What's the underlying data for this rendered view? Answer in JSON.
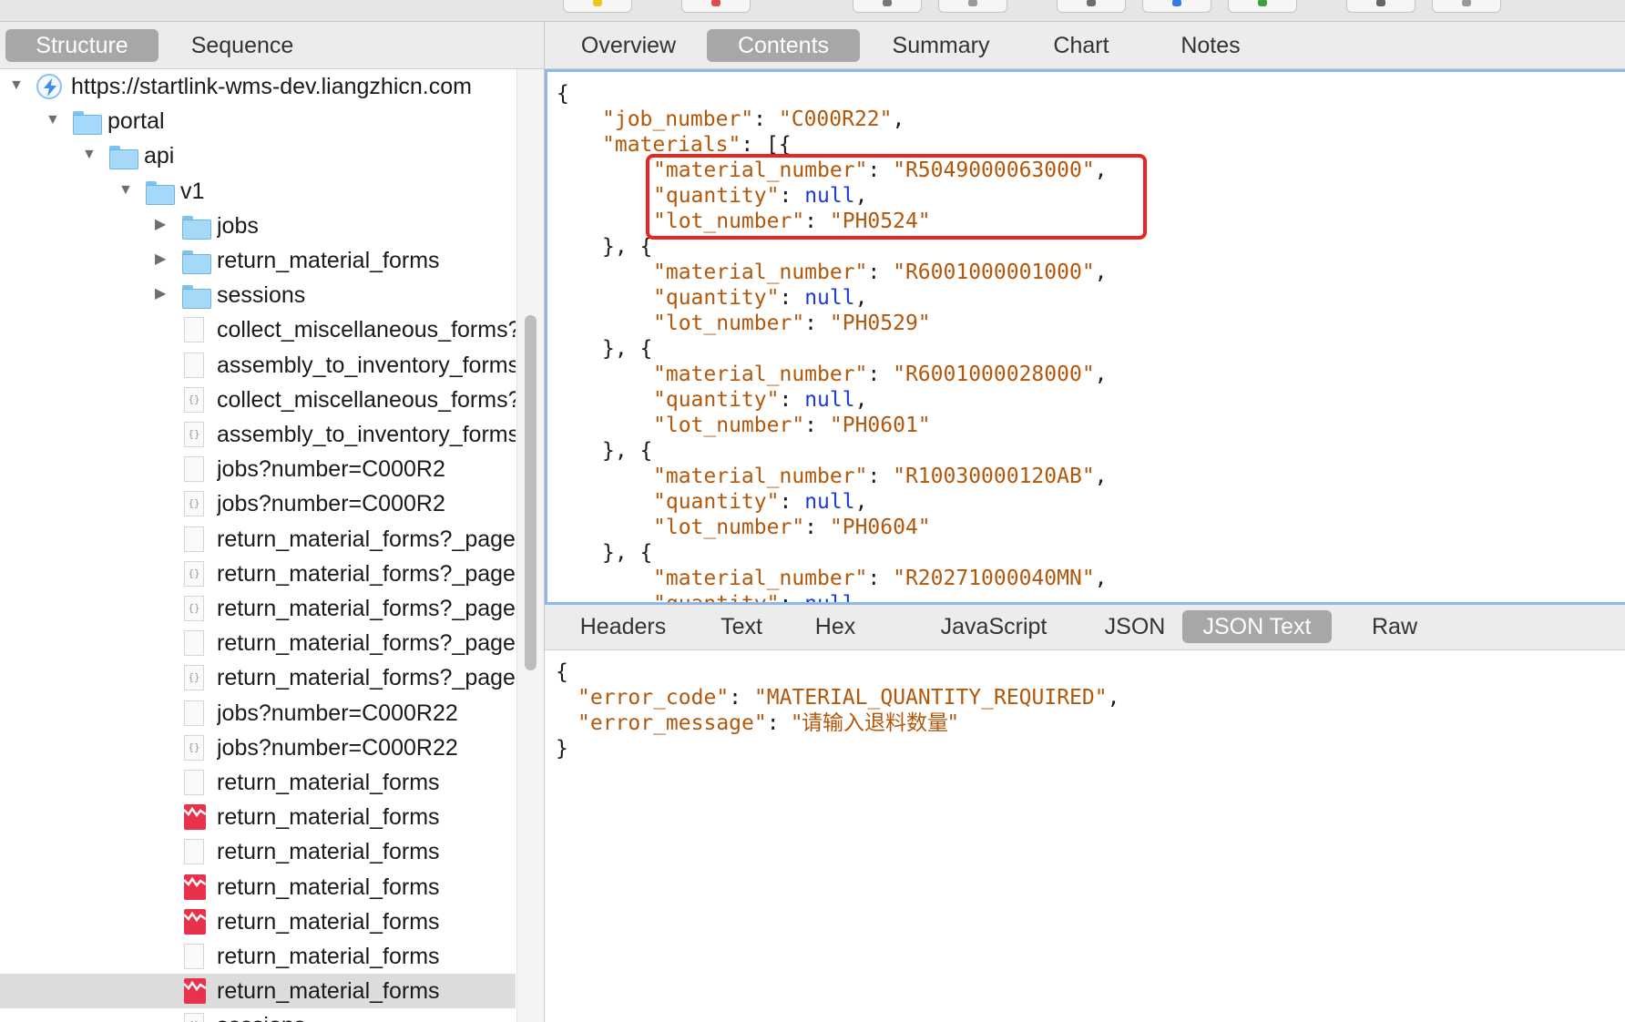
{
  "toolbar": {
    "buttons": [
      {
        "icon": "pen-icon",
        "color": "#f0c419"
      },
      {
        "icon": "record-icon",
        "color": "#e24b4b"
      },
      {
        "icon": "throttle-icon",
        "color": "#777777"
      },
      {
        "icon": "clear-icon",
        "color": "#999999"
      },
      {
        "icon": "search-icon",
        "color": "#6e6e6e"
      },
      {
        "icon": "compose-icon",
        "color": "#2f7de1"
      },
      {
        "icon": "check-icon",
        "color": "#3aa141"
      },
      {
        "icon": "tools-icon",
        "color": "#666666"
      },
      {
        "icon": "settings-icon",
        "color": "#999999"
      }
    ]
  },
  "left_tabs": [
    {
      "label": "Structure",
      "active": true
    },
    {
      "label": "Sequence",
      "active": false
    }
  ],
  "tree": {
    "host": "https://startlink-wms-dev.liangzhicn.com",
    "rows": [
      {
        "label": "portal",
        "icon": "folder",
        "level": 1,
        "expanded": true
      },
      {
        "label": "api",
        "icon": "folder",
        "level": 2,
        "expanded": true
      },
      {
        "label": "v1",
        "icon": "folder",
        "level": 3,
        "expanded": true
      },
      {
        "label": "jobs",
        "icon": "folder",
        "level": 4,
        "expanded": false
      },
      {
        "label": "return_material_forms",
        "icon": "folder",
        "level": 4,
        "expanded": false
      },
      {
        "label": "sessions",
        "icon": "folder",
        "level": 4,
        "expanded": false
      },
      {
        "label": "collect_miscellaneous_forms?",
        "icon": "doc",
        "level": 4
      },
      {
        "label": "assembly_to_inventory_forms",
        "icon": "doc",
        "level": 4
      },
      {
        "label": "collect_miscellaneous_forms?",
        "icon": "json",
        "level": 4
      },
      {
        "label": "assembly_to_inventory_forms",
        "icon": "json",
        "level": 4
      },
      {
        "label": "jobs?number=C000R2",
        "icon": "doc",
        "level": 4
      },
      {
        "label": "jobs?number=C000R2",
        "icon": "json",
        "level": 4
      },
      {
        "label": "return_material_forms?_page=",
        "icon": "doc",
        "level": 4
      },
      {
        "label": "return_material_forms?_page=",
        "icon": "json",
        "level": 4
      },
      {
        "label": "return_material_forms?_page=",
        "icon": "json",
        "level": 4
      },
      {
        "label": "return_material_forms?_page=",
        "icon": "doc",
        "level": 4
      },
      {
        "label": "return_material_forms?_page=",
        "icon": "json",
        "level": 4
      },
      {
        "label": "jobs?number=C000R22",
        "icon": "doc",
        "level": 4
      },
      {
        "label": "jobs?number=C000R22",
        "icon": "json",
        "level": 4
      },
      {
        "label": "return_material_forms",
        "icon": "doc",
        "level": 4
      },
      {
        "label": "return_material_forms",
        "icon": "error",
        "level": 4
      },
      {
        "label": "return_material_forms",
        "icon": "doc",
        "level": 4
      },
      {
        "label": "return_material_forms",
        "icon": "error",
        "level": 4
      },
      {
        "label": "return_material_forms",
        "icon": "error",
        "level": 4
      },
      {
        "label": "return_material_forms",
        "icon": "doc",
        "level": 4
      },
      {
        "label": "return_material_forms",
        "icon": "error",
        "level": 4,
        "selected": true
      },
      {
        "label": "sessions",
        "icon": "json",
        "level": 4
      }
    ]
  },
  "top_tabs": [
    {
      "label": "Overview",
      "active": false
    },
    {
      "label": "Contents",
      "active": true
    },
    {
      "label": "Summary",
      "active": false
    },
    {
      "label": "Chart",
      "active": false
    },
    {
      "label": "Notes",
      "active": false
    }
  ],
  "request": {
    "job_number_key": "\"job_number\"",
    "job_number_value": "\"C000R22\"",
    "materials_key": "\"materials\"",
    "materials": [
      {
        "material_number": "\"R5049000063000\"",
        "quantity": "null",
        "lot_number": "\"PH0524\""
      },
      {
        "material_number": "\"R6001000001000\"",
        "quantity": "null",
        "lot_number": "\"PH0529\""
      },
      {
        "material_number": "\"R6001000028000\"",
        "quantity": "null",
        "lot_number": "\"PH0601\""
      },
      {
        "material_number": "\"R10030000120AB\"",
        "quantity": "null",
        "lot_number": "\"PH0604\""
      },
      {
        "material_number": "\"R20271000040MN\"",
        "quantity": "null"
      }
    ],
    "keys": {
      "material_number": "\"material_number\"",
      "quantity": "\"quantity\"",
      "lot_number": "\"lot_number\""
    }
  },
  "bottom_tabs": [
    {
      "label": "Headers",
      "active": false
    },
    {
      "label": "Text",
      "active": false
    },
    {
      "label": "Hex",
      "active": false
    },
    {
      "label": "JavaScript",
      "active": false
    },
    {
      "label": "JSON",
      "active": false
    },
    {
      "label": "JSON Text",
      "active": true
    },
    {
      "label": "Raw",
      "active": false
    }
  ],
  "response": {
    "error_code_key": "\"error_code\"",
    "error_code_value": "\"MATERIAL_QUANTITY_REQUIRED\"",
    "error_message_key": "\"error_message\"",
    "error_message_value": "\"请输入退料数量\""
  },
  "colors": {
    "json_key": "#b3570a",
    "json_null": "#1d3cd6",
    "highlight": "#e8261d",
    "active_tab": "#a7a7a7"
  }
}
